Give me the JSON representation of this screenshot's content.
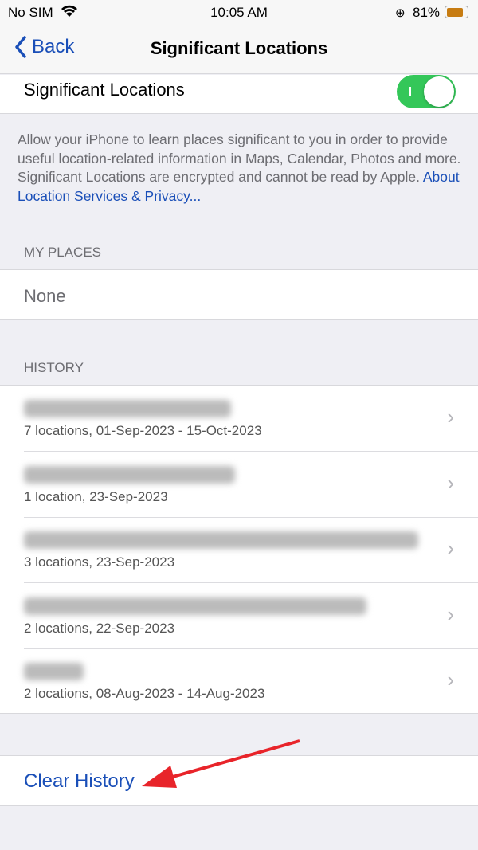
{
  "status_bar": {
    "carrier": "No SIM",
    "time": "10:05 AM",
    "battery": "81%",
    "battery_level": 81,
    "battery_color": "#c77c12"
  },
  "nav": {
    "back_label": "Back",
    "title": "Significant Locations"
  },
  "toggle": {
    "label": "Significant Locations",
    "on": true,
    "color": "#34c759"
  },
  "description": {
    "text": "Allow your iPhone to learn places significant to you in order to provide useful location-related information in Maps, Calendar, Photos and more. Significant Locations are encrypted and cannot be read by Apple. ",
    "link": "About Location Services & Privacy..."
  },
  "my_places": {
    "header": "MY PLACES",
    "items": [
      "None"
    ]
  },
  "history": {
    "header": "HISTORY",
    "items": [
      {
        "detail": "7 locations, 01-Sep-2023 - 15-Oct-2023"
      },
      {
        "detail": "1 location, 23-Sep-2023"
      },
      {
        "detail": "3 locations, 23-Sep-2023"
      },
      {
        "detail": "2 locations, 22-Sep-2023"
      },
      {
        "detail": "2 locations, 08-Aug-2023 - 14-Aug-2023"
      }
    ]
  },
  "clear_history_label": "Clear History",
  "accent": "#1a4fb8"
}
